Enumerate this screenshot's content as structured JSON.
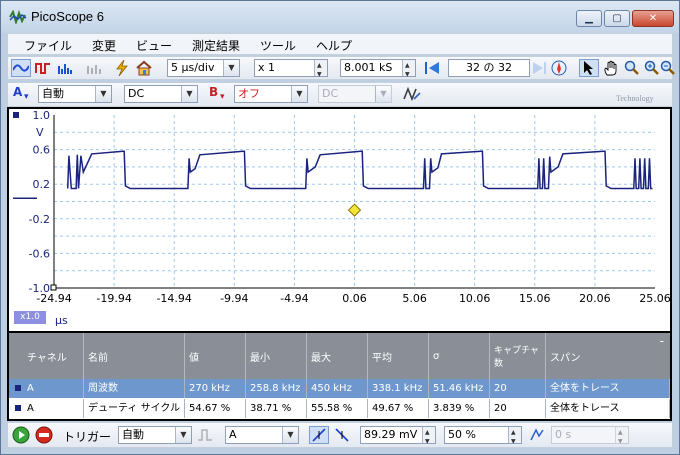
{
  "window": {
    "title": "PicoScope 6"
  },
  "menu": [
    "ファイル",
    "変更",
    "ビュー",
    "測定結果",
    "ツール",
    "ヘルプ"
  ],
  "toolbar": {
    "timebase": "5 µs/div",
    "zoom": "x 1",
    "samples": "8.001 kS",
    "buffer_current": "32",
    "buffer_sep": "の",
    "buffer_total": "32"
  },
  "channels": {
    "a_letter": "A",
    "a_range": "自動",
    "a_coupling": "DC",
    "b_letter": "B",
    "b_range": "オフ",
    "b_coupling": "DC",
    "brand_watermark": "Technology"
  },
  "scope": {
    "y_unit": "V",
    "y_ticks": [
      "1.0",
      "0.6",
      "0.2",
      "-0.2",
      "-0.6",
      "-1.0"
    ],
    "x_ticks": [
      "-24.94",
      "-19.94",
      "-14.94",
      "-9.94",
      "-4.94",
      "0.06",
      "5.06",
      "10.06",
      "15.06",
      "20.06",
      "25.06"
    ],
    "x_unit": "µs",
    "zoom_badge": "x1.0",
    "trace_color": "#1a237e"
  },
  "measurements": {
    "headers": [
      "チャネル",
      "名前",
      "値",
      "最小",
      "最大",
      "平均",
      "σ",
      "キャプチャ数",
      "スパン"
    ],
    "rows": [
      [
        "A",
        "周波数",
        "270 kHz",
        "258.8 kHz",
        "450 kHz",
        "338.1 kHz",
        "51.46 kHz",
        "20",
        "全体をトレース"
      ],
      [
        "A",
        "デューティ サイクル",
        "54.67 %",
        "38.71 %",
        "55.58 %",
        "49.67 %",
        "3.839 %",
        "20",
        "全体をトレース"
      ]
    ]
  },
  "status": {
    "trigger_label": "トリガー",
    "trigger_mode": "自動",
    "trigger_channel": "A",
    "threshold": "89.29 mV",
    "pre_trigger": "50 %",
    "delay": "0 s"
  }
}
